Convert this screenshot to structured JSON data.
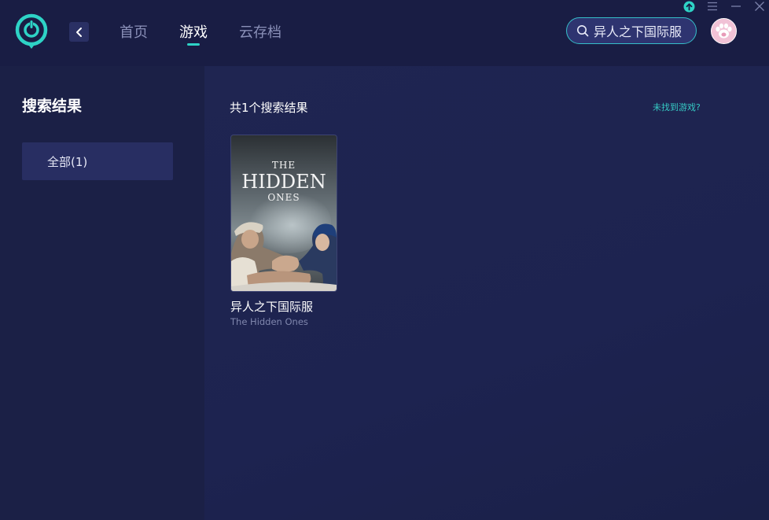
{
  "header": {
    "nav": [
      {
        "label": "首页"
      },
      {
        "label": "游戏"
      },
      {
        "label": "云存档"
      }
    ],
    "active_tab": "游戏",
    "search": {
      "value": "异人之下国际服"
    }
  },
  "sidebar": {
    "title": "搜索结果",
    "filters": [
      {
        "label": "全部(1)"
      }
    ]
  },
  "main": {
    "result_count": "共1个搜索结果",
    "not_found_link": "未找到游戏?",
    "games": [
      {
        "name": "异人之下国际服",
        "subtitle": "The Hidden Ones",
        "cover_text": {
          "line1": "THE",
          "line2": "HIDDEN",
          "line3": "ONES"
        }
      }
    ]
  },
  "colors": {
    "accent": "#2ed3c6",
    "background": "#1c214a",
    "sidebar": "#1b2046"
  },
  "icons": [
    "app-logo-icon",
    "back-arrow-icon",
    "search-icon",
    "upload-icon",
    "menu-icon",
    "minimize-icon",
    "close-icon",
    "avatar-paw-icon"
  ]
}
